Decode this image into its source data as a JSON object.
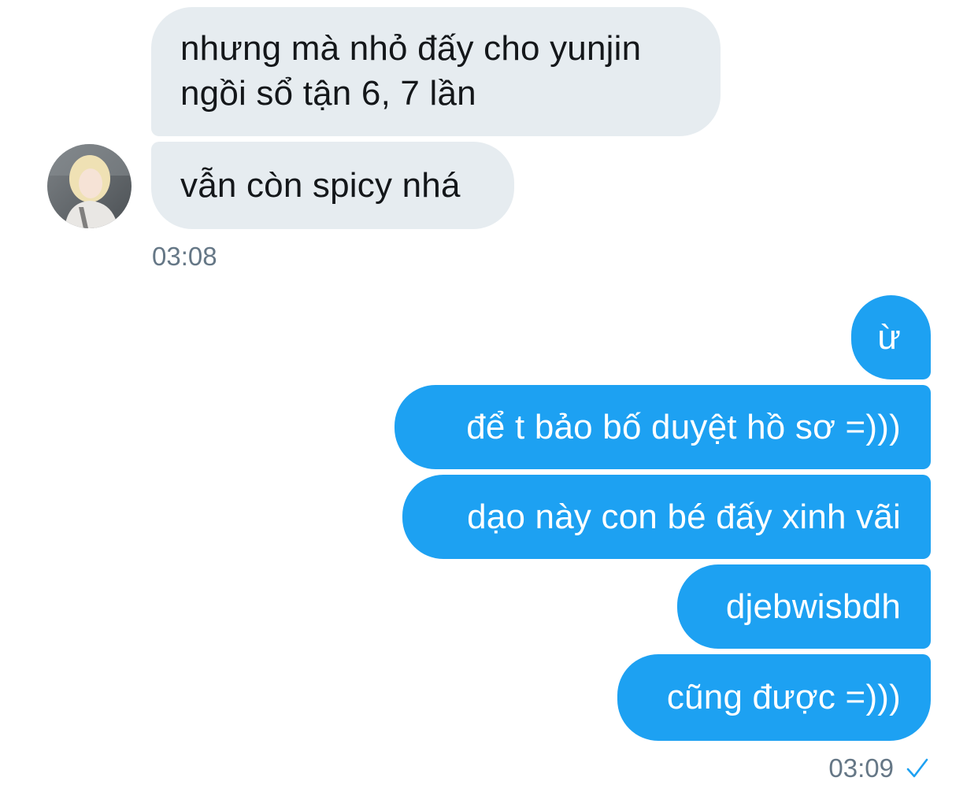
{
  "conversation": {
    "incoming": [
      {
        "lines": [
          "nhưng mà nhỏ đấy cho yunjin",
          "ngồi sổ tận 6, 7 lần"
        ]
      },
      {
        "lines": [
          "vẫn còn spicy nhá"
        ]
      }
    ],
    "incoming_time": "03:08",
    "outgoing": [
      {
        "text": "ừ"
      },
      {
        "text": "để t bảo bố duyệt hồ sơ =)))"
      },
      {
        "text": "dạo này con bé đấy xinh vãi"
      },
      {
        "text": "djebwisbdh"
      },
      {
        "text": "cũng được =)))"
      }
    ],
    "outgoing_time": "03:09"
  },
  "icons": {
    "avatar": "contact-avatar",
    "read_status": "checkmark-icon"
  },
  "colors": {
    "incoming_bubble": "#e6ecf0",
    "outgoing_bubble": "#1da1f2",
    "timestamp": "#657786"
  }
}
